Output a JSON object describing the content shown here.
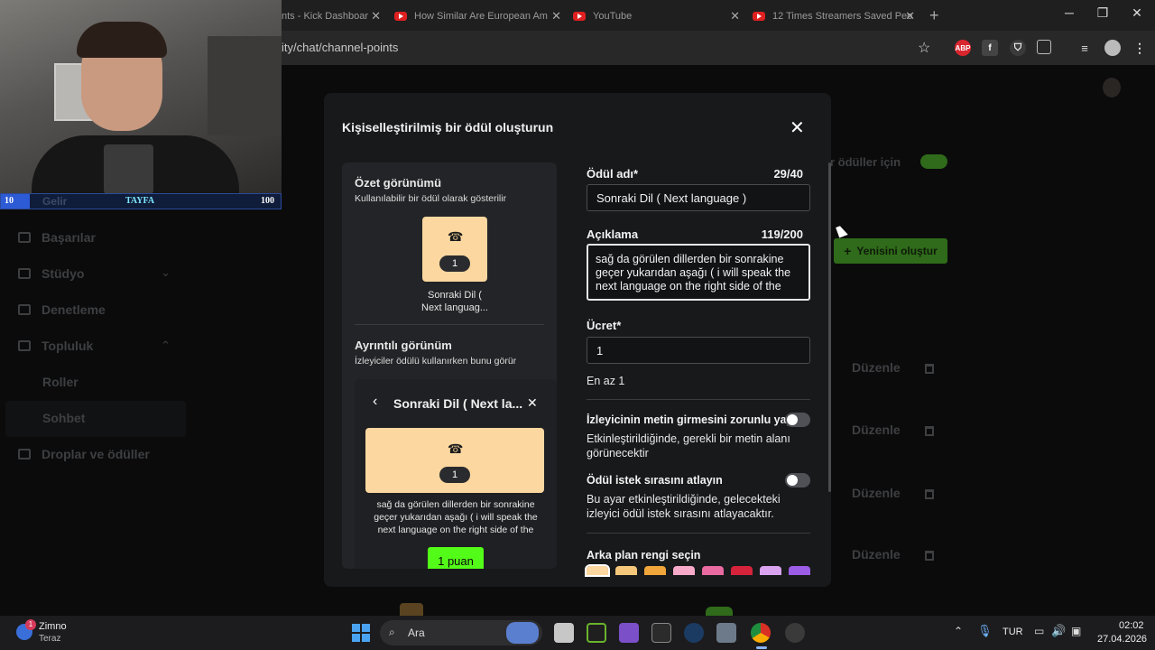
{
  "browser": {
    "tabs": [
      {
        "title": "nts - Kick Dashboar"
      },
      {
        "title": "How Similar Are European Am"
      },
      {
        "title": "YouTube"
      },
      {
        "title": "12 Times Streamers Saved Peo"
      }
    ],
    "url": "ity/chat/channel-points"
  },
  "overlay": {
    "left_num": "10",
    "label": "Gelir",
    "center": "TAYFA",
    "right_num": "100"
  },
  "sidebar": {
    "items": [
      {
        "label": "Başarılar"
      },
      {
        "label": "Stüdyo"
      },
      {
        "label": "Denetleme"
      },
      {
        "label": "Topluluk"
      },
      {
        "label": "Roller"
      },
      {
        "label": "Sohbet"
      },
      {
        "label": "Droplar ve ödüller"
      }
    ]
  },
  "background": {
    "toggle_text": "r ödüller için",
    "create_button": "Yenisini oluştur",
    "edit_label": "Düzenle"
  },
  "modal": {
    "title": "Kişiselleştirilmiş bir ödül oluşturun",
    "summary": {
      "title": "Özet görünümü",
      "subtitle": "Kullanılabilir bir ödül olarak gösterilir",
      "cost": "1",
      "name_line1": "Sonraki Dil (",
      "name_line2": "Next languag..."
    },
    "detail": {
      "title": "Ayrıntılı görünüm",
      "subtitle": "İzleyiciler ödülü kullanırken bunu görür",
      "header": "Sonraki Dil ( Next la...",
      "cost": "1",
      "description_line1": "sağ da görülen dillerden bir sonrakine",
      "description_line2": "geçer yukarıdan aşağı ( i will speak the",
      "description_line3": "next language on the right side of the",
      "button": "1 puan"
    },
    "form": {
      "name_label": "Ödül adı*",
      "name_count": "29/40",
      "name_value": "Sonraki Dil ( Next language )",
      "desc_label": "Açıklama",
      "desc_count": "119/200",
      "desc_line1": "sağ da görülen dillerden bir sonrakine",
      "desc_line2": "geçer yukarıdan aşağı ( i will speak the",
      "desc_line3": "next language on the right side of the",
      "cost_label": "Ücret*",
      "cost_value": "1",
      "cost_hint": "En az 1",
      "require_text_label": "İzleyicinin metin girmesini zorunlu yap",
      "require_text_hint1": "Etkinleştirildiğinde, gerekli bir metin alanı",
      "require_text_hint2": "görünecektir",
      "skip_queue_label": "Ödül istek sırasını atlayın",
      "skip_queue_hint1": "Bu ayar etkinleştirildiğinde, gelecekteki",
      "skip_queue_hint2": "izleyici ödül istek sırasını atlayacaktır.",
      "bg_color_label": "Arka plan rengi seçin"
    },
    "colors": [
      "#fcd79f",
      "#f5c77a",
      "#f0a63a",
      "#f7a9c9",
      "#e86aa0",
      "#d6233c",
      "#d9a3f0",
      "#9b5de5"
    ]
  },
  "taskbar": {
    "weather_temp": "Zimno",
    "weather_sub": "Teraz",
    "search": "Ara",
    "lang": "TUR",
    "time": "02:02",
    "date": "27.04.2026",
    "notif_badge": "1"
  }
}
